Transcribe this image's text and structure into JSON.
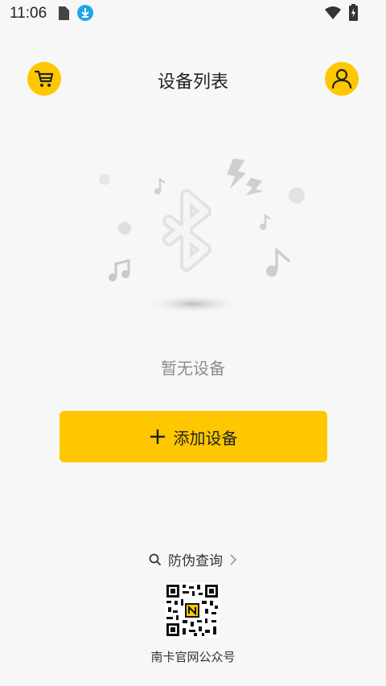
{
  "status_bar": {
    "time": "11:06"
  },
  "header": {
    "title": "设备列表",
    "cart_icon": "cart-icon",
    "user_icon": "user-icon"
  },
  "empty_state": {
    "text": "暂无设备",
    "illustration_icon": "bluetooth-icon"
  },
  "actions": {
    "add_device_label": "添加设备"
  },
  "footer": {
    "verify_label": "防伪查询",
    "qr_caption": "南卡官网公众号"
  },
  "colors": {
    "accent": "#ffc700",
    "background": "#f7f7f7",
    "muted_text": "#8c8c8c",
    "download_badge": "#1ea7e8"
  }
}
